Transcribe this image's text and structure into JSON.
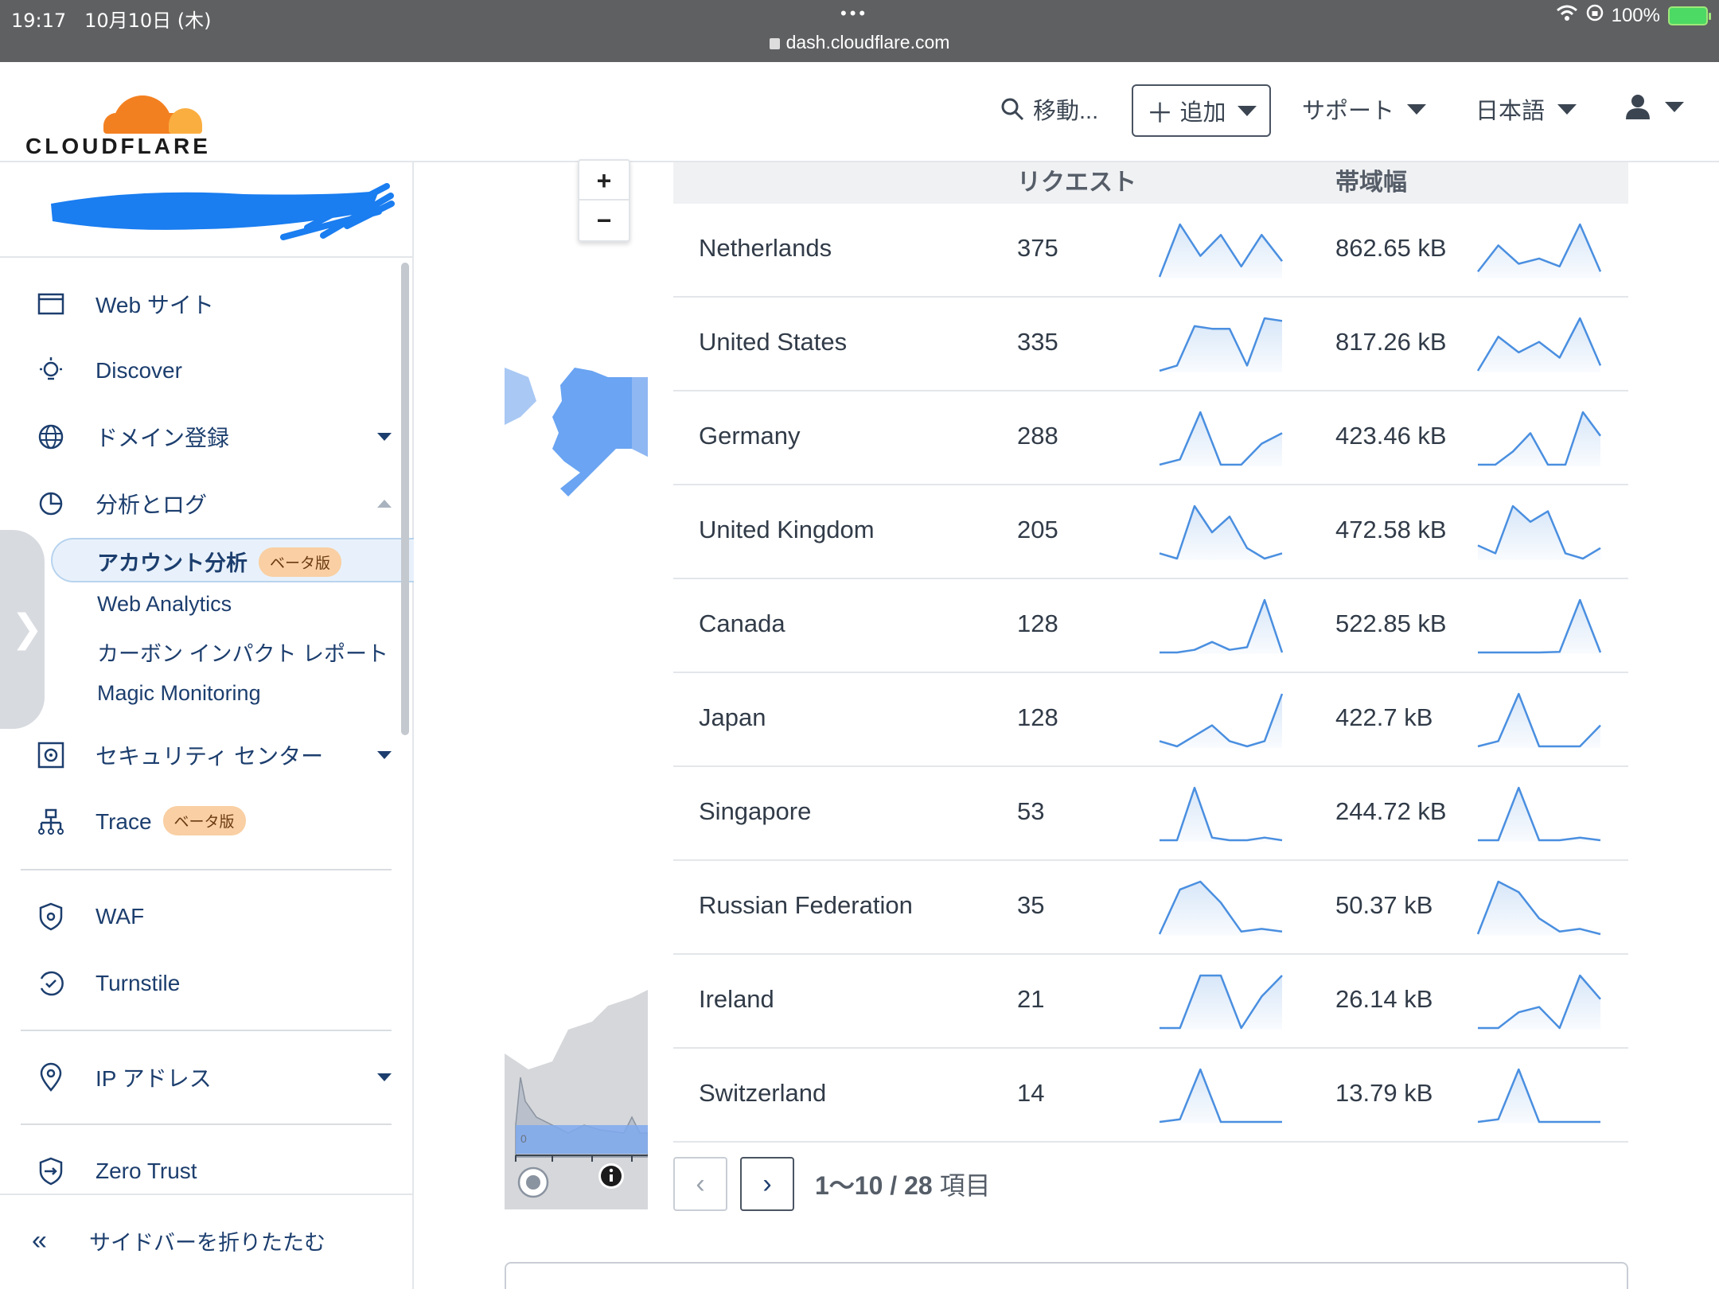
{
  "status_bar": {
    "time": "19:17",
    "date": "10月10日 (木)",
    "url": "dash.cloudflare.com",
    "battery": "100%"
  },
  "header": {
    "logo_text": "CLOUDFLARE",
    "search_label": "移動...",
    "add_label": "追加",
    "support_label": "サポート",
    "language_label": "日本語"
  },
  "sidebar": {
    "items": [
      {
        "label": "Web サイト"
      },
      {
        "label": "Discover"
      },
      {
        "label": "ドメイン登録"
      },
      {
        "label": "分析とログ"
      }
    ],
    "sub_items": [
      {
        "label": "アカウント分析",
        "badge": "ベータ版"
      },
      {
        "label": "Web Analytics"
      },
      {
        "label": "カーボン インパクト レポート"
      },
      {
        "label": "Magic Monitoring"
      }
    ],
    "items2": [
      {
        "label": "セキュリティ センター"
      },
      {
        "label": "Trace",
        "badge": "ベータ版"
      },
      {
        "label": "WAF"
      },
      {
        "label": "Turnstile"
      },
      {
        "label": "IP アドレス"
      },
      {
        "label": "Zero Trust"
      }
    ],
    "collapse_label": "サイドバーを折りたたむ"
  },
  "map": {
    "zoom_in": "+",
    "zoom_out": "−",
    "axis_zero": "0"
  },
  "table": {
    "columns": {
      "requests": "リクエスト",
      "bandwidth": "帯域幅"
    },
    "rows": [
      {
        "country": "Netherlands",
        "requests": "375",
        "bandwidth": "862.65 kB",
        "req_trend": [
          0,
          1,
          0.4,
          0.8,
          0.2,
          0.8,
          0.3
        ],
        "bw_trend": [
          0.1,
          0.6,
          0.25,
          0.35,
          0.2,
          1,
          0.1
        ]
      },
      {
        "country": "United States",
        "requests": "335",
        "bandwidth": "817.26 kB",
        "req_trend": [
          0,
          0.1,
          0.85,
          0.8,
          0.8,
          0.1,
          1,
          0.95
        ],
        "bw_trend": [
          0,
          0.65,
          0.35,
          0.55,
          0.25,
          1,
          0.1
        ]
      },
      {
        "country": "Germany",
        "requests": "288",
        "bandwidth": "423.46 kB",
        "req_trend": [
          0,
          0.1,
          1,
          0,
          0,
          0.4,
          0.6
        ],
        "bw_trend": [
          0,
          0,
          0.25,
          0.6,
          0,
          0,
          1,
          0.55
        ]
      },
      {
        "country": "United Kingdom",
        "requests": "205",
        "bandwidth": "472.58 kB",
        "req_trend": [
          0.1,
          0,
          1,
          0.5,
          0.8,
          0.2,
          0,
          0.1
        ],
        "bw_trend": [
          0.25,
          0.1,
          1,
          0.7,
          0.9,
          0.1,
          0,
          0.2
        ]
      },
      {
        "country": "Canada",
        "requests": "128",
        "bandwidth": "522.85 kB",
        "req_trend": [
          0,
          0,
          0.05,
          0.2,
          0.05,
          0.1,
          1,
          0
        ],
        "bw_trend": [
          0,
          0,
          0,
          0,
          0.01,
          1,
          0
        ]
      },
      {
        "country": "Japan",
        "requests": "128",
        "bandwidth": "422.7 kB",
        "req_trend": [
          0.1,
          0,
          0.2,
          0.4,
          0.1,
          0,
          0.1,
          1
        ],
        "bw_trend": [
          0,
          0.1,
          1,
          0,
          0,
          0,
          0.4
        ]
      },
      {
        "country": "Singapore",
        "requests": "53",
        "bandwidth": "244.72 kB",
        "req_trend": [
          0,
          0,
          1,
          0.05,
          0,
          0,
          0.05,
          0
        ],
        "bw_trend": [
          0,
          0,
          1,
          0,
          0,
          0.05,
          0
        ]
      },
      {
        "country": "Russian Federation",
        "requests": "35",
        "bandwidth": "50.37 kB",
        "req_trend": [
          0,
          0.85,
          1,
          0.6,
          0.05,
          0.1,
          0.05
        ],
        "bw_trend": [
          0,
          1,
          0.8,
          0.3,
          0.05,
          0.1,
          0
        ]
      },
      {
        "country": "Ireland",
        "requests": "21",
        "bandwidth": "26.14 kB",
        "req_trend": [
          0,
          0,
          1,
          1,
          0,
          0.6,
          1
        ],
        "bw_trend": [
          0,
          0,
          0.3,
          0.4,
          0,
          1,
          0.55
        ]
      },
      {
        "country": "Switzerland",
        "requests": "14",
        "bandwidth": "13.79 kB",
        "req_trend": [
          0,
          0.05,
          1,
          0,
          0,
          0,
          0
        ],
        "bw_trend": [
          0,
          0.05,
          1,
          0,
          0,
          0,
          0
        ]
      }
    ]
  },
  "pagination": {
    "range": "1〜10 / 28",
    "unit": "項目"
  },
  "colors": {
    "accent": "#1c3e6e",
    "brand_orange": "#f38020",
    "sparkline": "#4a8fe0"
  }
}
